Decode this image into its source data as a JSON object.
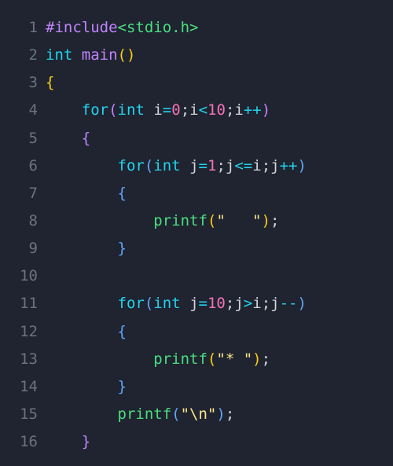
{
  "code": {
    "line1": {
      "n": "1",
      "include": "#include",
      "header": "<stdio.h>"
    },
    "line2": {
      "n": "2",
      "int": "int",
      "main": "main",
      "lp": "(",
      "rp": ")"
    },
    "line3": {
      "n": "3",
      "brace": "{"
    },
    "line4": {
      "n": "4",
      "indent": "    ",
      "for": "for",
      "lp": "(",
      "int": "int",
      "i": "i",
      "eq": "=",
      "z": "0",
      "s1": ";",
      "i2": "i",
      "lt": "<",
      "ten": "10",
      "s2": ";",
      "i3": "i",
      "pp": "++",
      "rp": ")"
    },
    "line5": {
      "n": "5",
      "indent": "    ",
      "brace": "{"
    },
    "line6": {
      "n": "6",
      "indent": "        ",
      "for": "for",
      "lp": "(",
      "int": "int",
      "j": "j",
      "eq": "=",
      "one": "1",
      "s1": ";",
      "j2": "j",
      "le": "<=",
      "i": "i",
      "s2": ";",
      "j3": "j",
      "pp": "++",
      "rp": ")"
    },
    "line7": {
      "n": "7",
      "indent": "        ",
      "brace": "{"
    },
    "line8": {
      "n": "8",
      "indent": "            ",
      "printf": "printf",
      "lp": "(",
      "str": "\"   \"",
      "rp": ")",
      "semi": ";"
    },
    "line9": {
      "n": "9",
      "indent": "        ",
      "brace": "}"
    },
    "line10": {
      "n": "10",
      "indent": ""
    },
    "line11": {
      "n": "11",
      "indent": "        ",
      "for": "for",
      "lp": "(",
      "int": "int",
      "j": "j",
      "eq": "=",
      "ten": "10",
      "s1": ";",
      "j2": "j",
      "gt": ">",
      "i": "i",
      "s2": ";",
      "j3": "j",
      "mm": "--",
      "rp": ")"
    },
    "line12": {
      "n": "12",
      "indent": "        ",
      "brace": "{"
    },
    "line13": {
      "n": "13",
      "indent": "            ",
      "printf": "printf",
      "lp": "(",
      "str": "\"* \"",
      "rp": ")",
      "semi": ";"
    },
    "line14": {
      "n": "14",
      "indent": "        ",
      "brace": "}"
    },
    "line15": {
      "n": "15",
      "indent": "        ",
      "printf": "printf",
      "lp": "(",
      "str": "\"\\n\"",
      "rp": ")",
      "semi": ";"
    },
    "line16": {
      "n": "16",
      "indent": "    ",
      "brace": "}"
    }
  }
}
